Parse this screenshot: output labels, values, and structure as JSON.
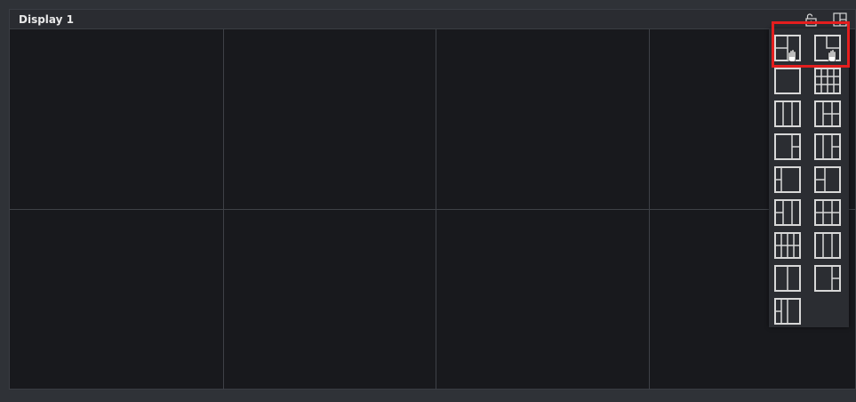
{
  "window": {
    "title": "Display 1"
  },
  "titlebar_icons": [
    "lock-icon",
    "layout-icon"
  ],
  "grid": {
    "rows": 2,
    "cols": 4
  },
  "layout_panel": {
    "items": [
      "layout-custom-hand-icon",
      "layout-pip-hand-icon",
      "layout-1-icon",
      "layout-2x3-grid-icon",
      "layout-3-col-icon",
      "layout-2x2-col-icon",
      "layout-2-col-split-icon",
      "layout-2-col-split-b-icon",
      "layout-1-plus-2-left-icon",
      "layout-2-col-mixed-icon",
      "layout-3-col-split-icon",
      "layout-3x2-grid-icon",
      "layout-4x3-grid-icon",
      "layout-3-col-wide-icon",
      "layout-2-col-icon",
      "layout-2-col-right-split-icon",
      "layout-3-col-small-split-icon"
    ]
  },
  "colors": {
    "background": "#2f3237",
    "viewport": "#18191d",
    "titlebar": "#2a2c31",
    "grid_line": "#3e4147",
    "icon_stroke": "#d8d8d8",
    "highlight": "#e41e1e"
  }
}
